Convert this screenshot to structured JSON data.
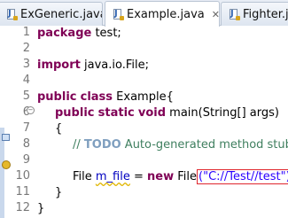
{
  "tabs": [
    {
      "label": "ExGeneric.java",
      "active": false,
      "icon": "java-file-icon"
    },
    {
      "label": "Example.java",
      "active": true,
      "icon": "java-file-icon",
      "close": "✕"
    },
    {
      "label": "Fighter.java",
      "active": false,
      "icon": "java-file-icon"
    }
  ],
  "editor": {
    "line_numbers": [
      "1",
      "2",
      "3",
      "4",
      "5",
      "6",
      "7",
      "8",
      "9",
      "10",
      "11",
      "12"
    ],
    "code": {
      "l1_kw": "package",
      "l1_rest": " test;",
      "l3_kw": "import",
      "l3_rest": " java.io.File;",
      "l5_kw1": "public",
      "l5_kw2": "class",
      "l5_rest": " Example{",
      "l6_kw1": "public",
      "l6_kw2": "static",
      "l6_kw3": "void",
      "l6_rest": " main(String[] args)",
      "l7": "{",
      "l8_comment": "// ",
      "l8_todo": "TODO",
      "l8_rest": " Auto-generated method stub",
      "l10_type": "File ",
      "l10_var": "m_file",
      "l10_eq": " = ",
      "l10_kw": "new",
      "l10_ctor": " File",
      "l10_arg": "(\"C://Test//test\");",
      "l11": "}",
      "l12": "}"
    }
  },
  "colors": {
    "keyword": "#7f0055",
    "comment": "#3f7f5f",
    "todo": "#7f9fbf",
    "string": "#2a00ff",
    "highlight_box": "#e0262d"
  }
}
